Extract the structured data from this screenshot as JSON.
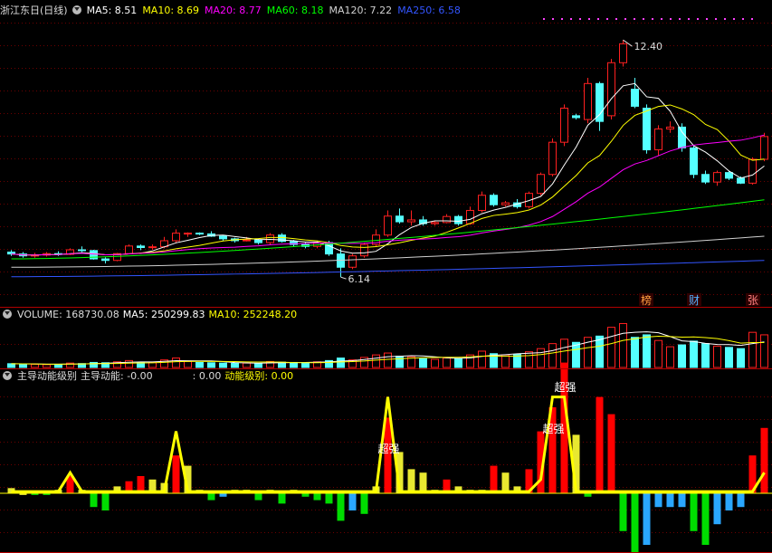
{
  "header": {
    "name": "浙江东日(日线)",
    "ma": [
      {
        "label": "MA5: 8.51",
        "color": "#ffffff"
      },
      {
        "label": "MA10: 8.69",
        "color": "#ffff00"
      },
      {
        "label": "MA20: 8.77",
        "color": "#ff00ff"
      },
      {
        "label": "MA60: 8.18",
        "color": "#00ff00"
      },
      {
        "label": "MA120: 7.22",
        "color": "#d0d0d0"
      },
      {
        "label": "MA250: 6.58",
        "color": "#3355ff"
      }
    ]
  },
  "vol_header": {
    "volume": "VOLUME: 168730.08",
    "ma5": "MA5: 250299.83",
    "ma10": "MA10: 252248.20"
  },
  "ind_header": {
    "name": "主导动能级别",
    "v1": "主导动能: -0.00",
    "v2": ": 0.00",
    "v3": "动能级别: 0.00"
  },
  "annotations": {
    "high": "12.40",
    "low": "6.14",
    "tags": [
      "榜",
      "财",
      "张"
    ],
    "strong1": "超强",
    "strong2": "超强",
    "strong3": "超强"
  },
  "colors": {
    "up": "#ff2020",
    "down": "#54ffff",
    "ma5": "#ffffff",
    "ma10": "#ffff00",
    "ma20": "#ff00ff",
    "ma60": "#00ff00",
    "ma120": "#d0d0d0",
    "ma250": "#3355ff",
    "grid": "#8b0000",
    "ind_red": "#ff0000",
    "ind_yellow": "#e8e830",
    "ind_green": "#00dd00",
    "ind_blue": "#2aa7ff"
  },
  "chart_data": {
    "type": "candlestick",
    "candles": [
      [
        6.8,
        6.85,
        6.7,
        6.75
      ],
      [
        6.75,
        6.8,
        6.65,
        6.7
      ],
      [
        6.7,
        6.78,
        6.65,
        6.72
      ],
      [
        6.72,
        6.8,
        6.68,
        6.76
      ],
      [
        6.76,
        6.82,
        6.7,
        6.74
      ],
      [
        6.74,
        6.9,
        6.72,
        6.86
      ],
      [
        6.86,
        6.95,
        6.8,
        6.84
      ],
      [
        6.84,
        6.86,
        6.6,
        6.62
      ],
      [
        6.62,
        6.66,
        6.5,
        6.58
      ],
      [
        6.58,
        6.78,
        6.56,
        6.76
      ],
      [
        6.76,
        7.0,
        6.74,
        6.96
      ],
      [
        6.96,
        7.0,
        6.85,
        6.92
      ],
      [
        6.92,
        7.0,
        6.86,
        6.94
      ],
      [
        6.94,
        7.2,
        6.9,
        7.1
      ],
      [
        7.1,
        7.4,
        7.05,
        7.3
      ],
      [
        7.3,
        7.32,
        7.2,
        7.3
      ],
      [
        7.3,
        7.32,
        7.25,
        7.28
      ],
      [
        7.28,
        7.35,
        7.2,
        7.22
      ],
      [
        7.22,
        7.25,
        7.1,
        7.15
      ],
      [
        7.15,
        7.18,
        7.05,
        7.1
      ],
      [
        7.1,
        7.2,
        7.08,
        7.12
      ],
      [
        7.12,
        7.15,
        7.0,
        7.05
      ],
      [
        7.05,
        7.3,
        7.0,
        7.25
      ],
      [
        7.25,
        7.3,
        7.05,
        7.08
      ],
      [
        7.08,
        7.12,
        6.95,
        7.0
      ],
      [
        7.0,
        7.05,
        6.9,
        6.95
      ],
      [
        6.95,
        7.1,
        6.9,
        7.05
      ],
      [
        7.05,
        7.1,
        6.7,
        6.75
      ],
      [
        6.75,
        6.9,
        6.14,
        6.4
      ],
      [
        6.4,
        6.75,
        6.35,
        6.7
      ],
      [
        6.7,
        7.05,
        6.65,
        7.0
      ],
      [
        7.0,
        7.4,
        6.95,
        7.25
      ],
      [
        7.25,
        7.9,
        7.2,
        7.75
      ],
      [
        7.75,
        7.95,
        7.55,
        7.6
      ],
      [
        7.6,
        7.9,
        7.5,
        7.65
      ],
      [
        7.65,
        7.75,
        7.5,
        7.55
      ],
      [
        7.55,
        7.62,
        7.5,
        7.58
      ],
      [
        7.58,
        7.8,
        7.56,
        7.74
      ],
      [
        7.74,
        7.78,
        7.5,
        7.55
      ],
      [
        7.55,
        8.0,
        7.52,
        7.9
      ],
      [
        7.9,
        8.4,
        7.85,
        8.3
      ],
      [
        8.3,
        8.35,
        8.0,
        8.05
      ],
      [
        8.05,
        8.15,
        8.0,
        8.1
      ],
      [
        8.1,
        8.2,
        7.95,
        8.0
      ],
      [
        8.0,
        8.4,
        7.95,
        8.35
      ],
      [
        8.35,
        8.9,
        8.3,
        8.85
      ],
      [
        8.85,
        9.8,
        8.8,
        9.7
      ],
      [
        9.7,
        10.7,
        9.6,
        10.6
      ],
      [
        10.4,
        10.45,
        10.3,
        10.35
      ],
      [
        10.3,
        11.4,
        10.2,
        11.25
      ],
      [
        11.25,
        11.3,
        10.0,
        10.25
      ],
      [
        10.4,
        11.9,
        10.3,
        11.8
      ],
      [
        11.8,
        12.4,
        11.7,
        12.3
      ],
      [
        11.1,
        11.4,
        10.6,
        10.65
      ],
      [
        10.6,
        10.7,
        9.4,
        9.5
      ],
      [
        9.5,
        10.15,
        9.35,
        10.05
      ],
      [
        10.05,
        10.25,
        9.95,
        10.1
      ],
      [
        10.1,
        10.2,
        9.45,
        9.55
      ],
      [
        9.55,
        9.6,
        8.75,
        8.85
      ],
      [
        8.85,
        8.95,
        8.6,
        8.65
      ],
      [
        8.65,
        8.95,
        8.55,
        8.9
      ],
      [
        8.9,
        8.95,
        8.7,
        8.75
      ],
      [
        8.75,
        8.8,
        8.6,
        8.62
      ],
      [
        8.62,
        9.3,
        8.58,
        9.25
      ],
      [
        9.25,
        9.95,
        9.2,
        9.85
      ]
    ],
    "volume": [
      60,
      55,
      50,
      45,
      48,
      70,
      62,
      80,
      75,
      90,
      110,
      85,
      80,
      120,
      150,
      95,
      80,
      75,
      70,
      65,
      70,
      60,
      95,
      85,
      80,
      75,
      90,
      110,
      150,
      120,
      160,
      200,
      230,
      180,
      170,
      140,
      130,
      150,
      140,
      200,
      260,
      220,
      200,
      210,
      250,
      300,
      380,
      450,
      400,
      480,
      500,
      640,
      700,
      480,
      520,
      430,
      330,
      360,
      420,
      380,
      340,
      320,
      300,
      560,
      520
    ],
    "indicator": [
      {
        "v": 0.015,
        "c": "ind_yellow"
      },
      {
        "v": -0.005,
        "c": "ind_yellow"
      },
      {
        "v": -0.005,
        "c": "ind_green"
      },
      {
        "v": -0.005,
        "c": "ind_green"
      },
      {
        "v": 0.01,
        "c": "ind_yellow"
      },
      {
        "v": 0.05,
        "c": "ind_red"
      },
      {
        "v": 0.01,
        "c": "ind_yellow"
      },
      {
        "v": -0.04,
        "c": "ind_green"
      },
      {
        "v": -0.05,
        "c": "ind_green"
      },
      {
        "v": 0.02,
        "c": "ind_yellow"
      },
      {
        "v": 0.035,
        "c": "ind_red"
      },
      {
        "v": 0.05,
        "c": "ind_red"
      },
      {
        "v": 0.04,
        "c": "ind_yellow"
      },
      {
        "v": 0.03,
        "c": "ind_yellow"
      },
      {
        "v": 0.11,
        "c": "ind_red"
      },
      {
        "v": 0.08,
        "c": "ind_yellow"
      },
      {
        "v": 0.01,
        "c": "ind_yellow"
      },
      {
        "v": -0.02,
        "c": "ind_green"
      },
      {
        "v": -0.01,
        "c": "ind_blue"
      },
      {
        "v": 0.01,
        "c": "ind_yellow"
      },
      {
        "v": 0.01,
        "c": "ind_yellow"
      },
      {
        "v": -0.02,
        "c": "ind_green"
      },
      {
        "v": 0.01,
        "c": "ind_yellow"
      },
      {
        "v": -0.03,
        "c": "ind_green"
      },
      {
        "v": 0.01,
        "c": "ind_yellow"
      },
      {
        "v": -0.01,
        "c": "ind_green"
      },
      {
        "v": -0.02,
        "c": "ind_green"
      },
      {
        "v": -0.03,
        "c": "ind_green"
      },
      {
        "v": -0.08,
        "c": "ind_green"
      },
      {
        "v": -0.05,
        "c": "ind_blue"
      },
      {
        "v": -0.06,
        "c": "ind_green"
      },
      {
        "v": 0.02,
        "c": "ind_yellow"
      },
      {
        "v": 0.22,
        "c": "ind_red"
      },
      {
        "v": 0.12,
        "c": "ind_yellow"
      },
      {
        "v": 0.07,
        "c": "ind_yellow"
      },
      {
        "v": 0.06,
        "c": "ind_yellow"
      },
      {
        "v": 0.01,
        "c": "ind_yellow"
      },
      {
        "v": 0.04,
        "c": "ind_red"
      },
      {
        "v": 0.02,
        "c": "ind_yellow"
      },
      {
        "v": 0.01,
        "c": "ind_yellow"
      },
      {
        "v": 0.01,
        "c": "ind_yellow"
      },
      {
        "v": 0.08,
        "c": "ind_red"
      },
      {
        "v": 0.06,
        "c": "ind_yellow"
      },
      {
        "v": 0.02,
        "c": "ind_yellow"
      },
      {
        "v": 0.07,
        "c": "ind_red"
      },
      {
        "v": 0.18,
        "c": "ind_red"
      },
      {
        "v": 0.25,
        "c": "ind_red"
      },
      {
        "v": 0.38,
        "c": "ind_red"
      },
      {
        "v": 0.17,
        "c": "ind_yellow"
      },
      {
        "v": -0.01,
        "c": "ind_green"
      },
      {
        "v": 0.28,
        "c": "ind_red"
      },
      {
        "v": 0.23,
        "c": "ind_red"
      },
      {
        "v": -0.11,
        "c": "ind_green"
      },
      {
        "v": -0.22,
        "c": "ind_green"
      },
      {
        "v": -0.15,
        "c": "ind_blue"
      },
      {
        "v": -0.04,
        "c": "ind_blue"
      },
      {
        "v": -0.04,
        "c": "ind_blue"
      },
      {
        "v": -0.04,
        "c": "ind_blue"
      },
      {
        "v": -0.11,
        "c": "ind_green"
      },
      {
        "v": -0.15,
        "c": "ind_green"
      },
      {
        "v": -0.09,
        "c": "ind_blue"
      },
      {
        "v": -0.05,
        "c": "ind_blue"
      },
      {
        "v": -0.04,
        "c": "ind_blue"
      },
      {
        "v": 0.11,
        "c": "ind_red"
      },
      {
        "v": 0.19,
        "c": "ind_red"
      }
    ],
    "level_line": [
      0.005,
      0.005,
      0.005,
      0.005,
      0.005,
      0.06,
      0.005,
      0.005,
      0.005,
      0.005,
      0.005,
      0.005,
      0.005,
      0.005,
      0.18,
      0.005,
      0.005,
      0.005,
      0.005,
      0.005,
      0.005,
      0.005,
      0.005,
      0.005,
      0.005,
      0.005,
      0.005,
      0.005,
      0.005,
      0.005,
      0.005,
      0.005,
      0.28,
      0.005,
      0.005,
      0.005,
      0.005,
      0.005,
      0.005,
      0.005,
      0.005,
      0.005,
      0.005,
      0.005,
      0.005,
      0.04,
      0.28,
      0.28,
      0.005,
      0.005,
      0.005,
      0.005,
      0.005,
      0.005,
      0.005,
      0.005,
      0.005,
      0.005,
      0.005,
      0.005,
      0.005,
      0.005,
      0.005,
      0.005,
      0.06
    ],
    "xlabel": "",
    "ylabel": ""
  }
}
